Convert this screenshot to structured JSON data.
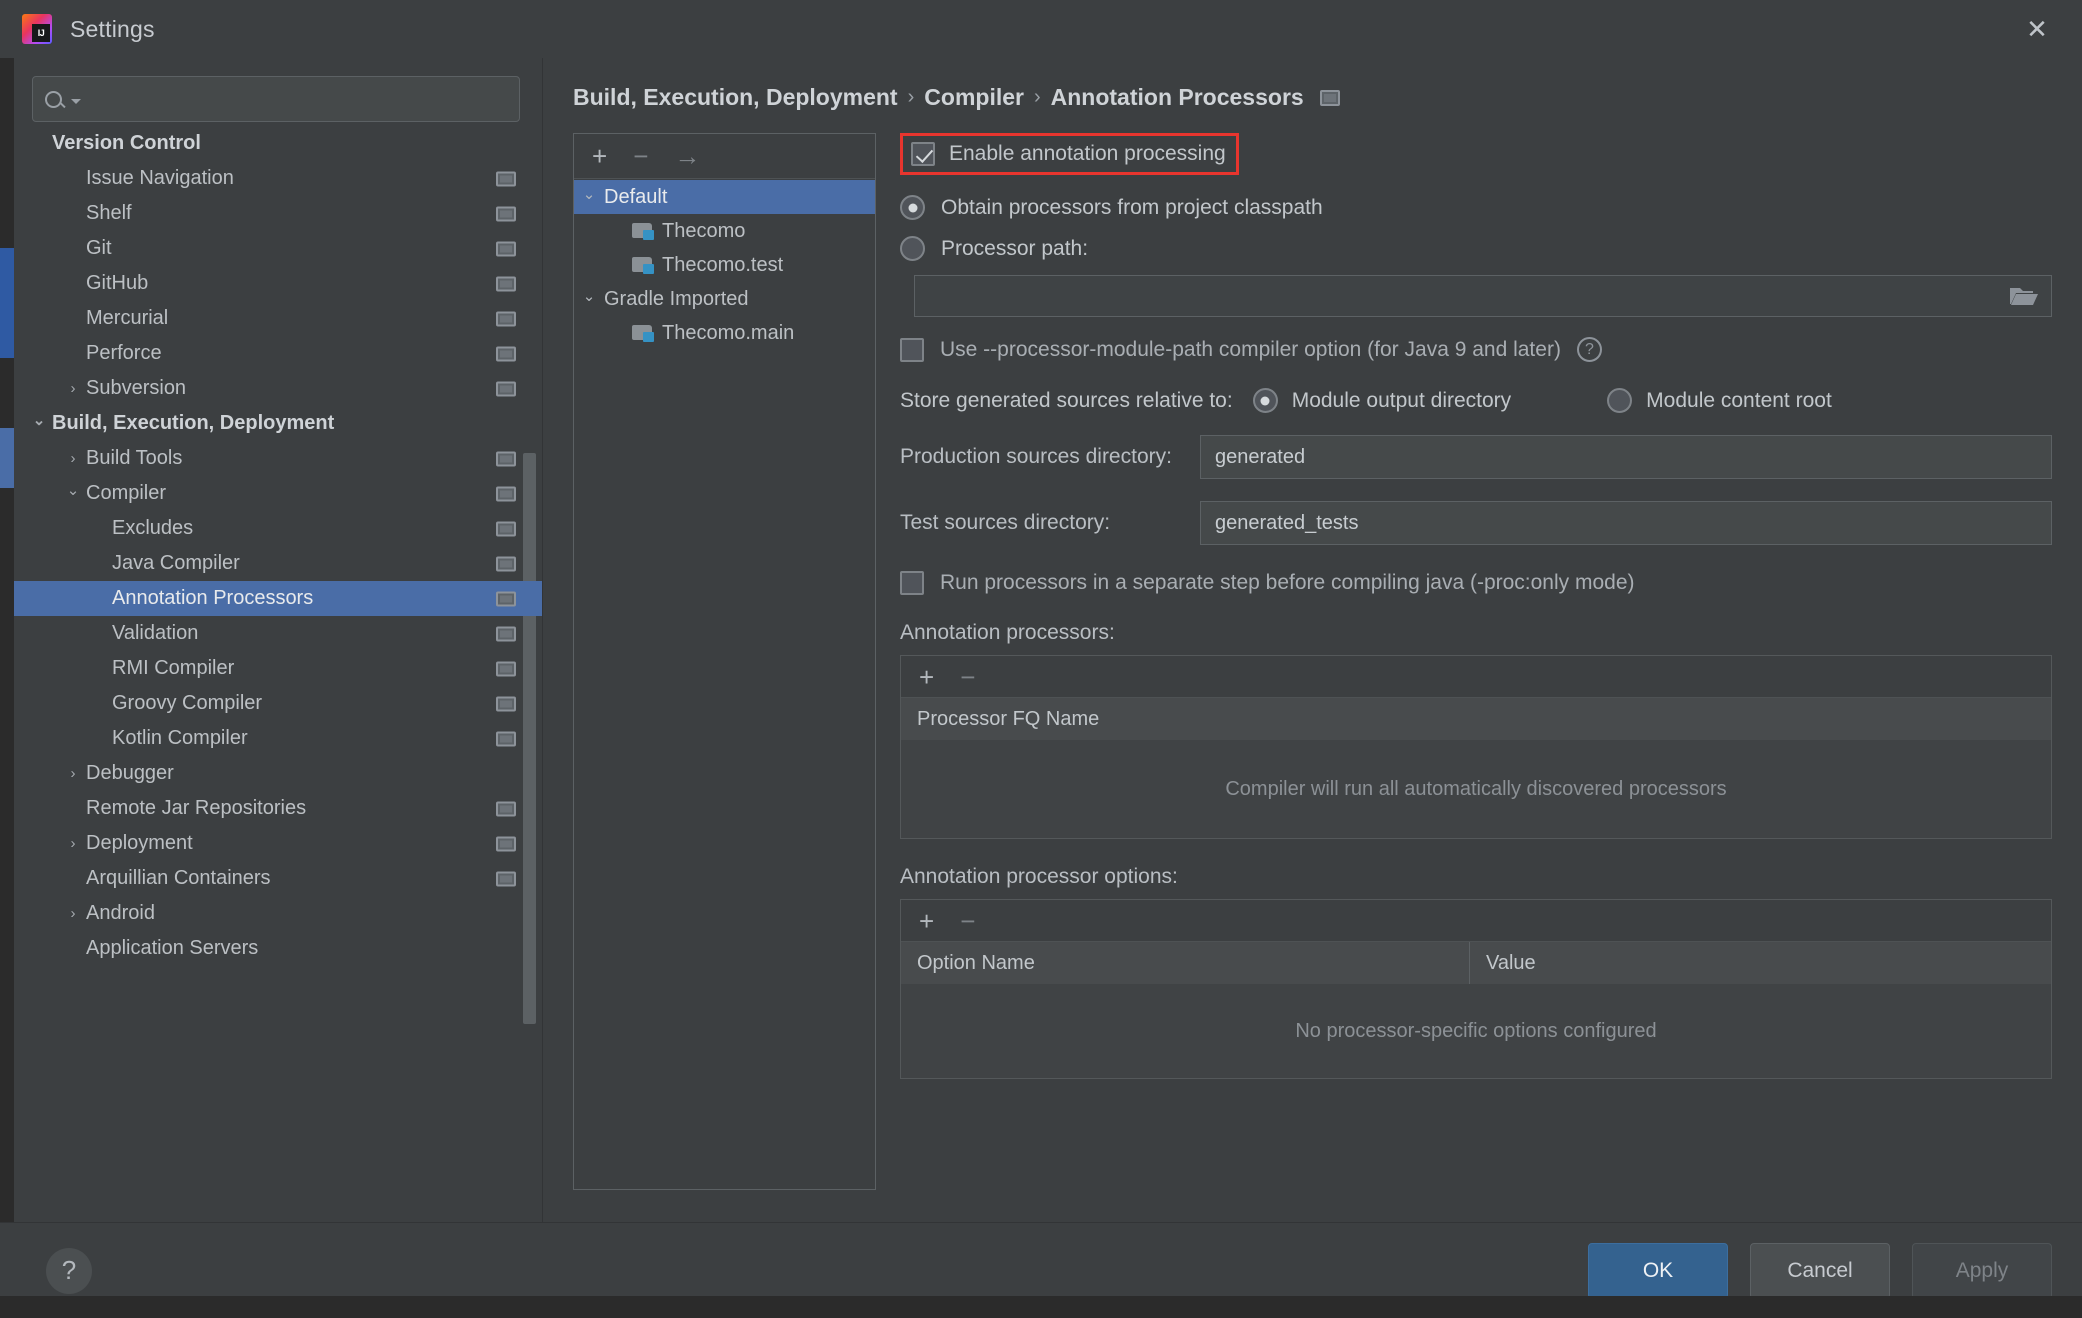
{
  "window": {
    "title": "Settings",
    "logo_icon": "intellij-idea-logo",
    "close_icon": "close-icon"
  },
  "search": {
    "value": "",
    "placeholder": "",
    "icon": "search-icon",
    "caret_icon": "chevron-down-icon"
  },
  "sidebar": {
    "scroll_thumb_top_pct": 30,
    "scroll_thumb_height_pct": 52,
    "items": [
      {
        "label": "Version Control",
        "depth": 0,
        "bold": true,
        "chevron": "",
        "badge": false,
        "selected": false
      },
      {
        "label": "Issue Navigation",
        "depth": 1,
        "bold": false,
        "chevron": "",
        "badge": true,
        "selected": false
      },
      {
        "label": "Shelf",
        "depth": 1,
        "bold": false,
        "chevron": "",
        "badge": true,
        "selected": false
      },
      {
        "label": "Git",
        "depth": 1,
        "bold": false,
        "chevron": "",
        "badge": true,
        "selected": false
      },
      {
        "label": "GitHub",
        "depth": 1,
        "bold": false,
        "chevron": "",
        "badge": true,
        "selected": false
      },
      {
        "label": "Mercurial",
        "depth": 1,
        "bold": false,
        "chevron": "",
        "badge": true,
        "selected": false
      },
      {
        "label": "Perforce",
        "depth": 1,
        "bold": false,
        "chevron": "",
        "badge": true,
        "selected": false
      },
      {
        "label": "Subversion",
        "depth": 1,
        "bold": false,
        "chevron": "collapsed",
        "badge": true,
        "selected": false
      },
      {
        "label": "Build, Execution, Deployment",
        "depth": 0,
        "bold": true,
        "chevron": "expanded",
        "badge": false,
        "selected": false
      },
      {
        "label": "Build Tools",
        "depth": 1,
        "bold": false,
        "chevron": "collapsed",
        "badge": true,
        "selected": false
      },
      {
        "label": "Compiler",
        "depth": 1,
        "bold": false,
        "chevron": "expanded",
        "badge": true,
        "selected": false
      },
      {
        "label": "Excludes",
        "depth": 2,
        "bold": false,
        "chevron": "",
        "badge": true,
        "selected": false
      },
      {
        "label": "Java Compiler",
        "depth": 2,
        "bold": false,
        "chevron": "",
        "badge": true,
        "selected": false
      },
      {
        "label": "Annotation Processors",
        "depth": 2,
        "bold": false,
        "chevron": "",
        "badge": true,
        "selected": true
      },
      {
        "label": "Validation",
        "depth": 2,
        "bold": false,
        "chevron": "",
        "badge": true,
        "selected": false
      },
      {
        "label": "RMI Compiler",
        "depth": 2,
        "bold": false,
        "chevron": "",
        "badge": true,
        "selected": false
      },
      {
        "label": "Groovy Compiler",
        "depth": 2,
        "bold": false,
        "chevron": "",
        "badge": true,
        "selected": false
      },
      {
        "label": "Kotlin Compiler",
        "depth": 2,
        "bold": false,
        "chevron": "",
        "badge": true,
        "selected": false
      },
      {
        "label": "Debugger",
        "depth": 1,
        "bold": false,
        "chevron": "collapsed",
        "badge": false,
        "selected": false
      },
      {
        "label": "Remote Jar Repositories",
        "depth": 1,
        "bold": false,
        "chevron": "",
        "badge": true,
        "selected": false
      },
      {
        "label": "Deployment",
        "depth": 1,
        "bold": false,
        "chevron": "collapsed",
        "badge": true,
        "selected": false
      },
      {
        "label": "Arquillian Containers",
        "depth": 1,
        "bold": false,
        "chevron": "",
        "badge": true,
        "selected": false
      },
      {
        "label": "Android",
        "depth": 1,
        "bold": false,
        "chevron": "collapsed",
        "badge": false,
        "selected": false
      },
      {
        "label": "Application Servers",
        "depth": 1,
        "bold": false,
        "chevron": "",
        "badge": false,
        "selected": false
      }
    ]
  },
  "breadcrumb": {
    "parts": [
      "Build, Execution, Deployment",
      "Compiler",
      "Annotation Processors"
    ],
    "separator": "›",
    "badge_icon": "ide-scope-icon"
  },
  "modules": {
    "toolbar": {
      "add_icon": "plus-icon",
      "remove_icon": "minus-icon",
      "move_icon": "arrow-right-icon"
    },
    "rows": [
      {
        "label": "Default",
        "type": "group",
        "chevron": "expanded",
        "selected": true
      },
      {
        "label": "Thecomo",
        "type": "module",
        "chevron": "",
        "selected": false
      },
      {
        "label": "Thecomo.test",
        "type": "module",
        "chevron": "",
        "selected": false
      },
      {
        "label": "Gradle Imported",
        "type": "group",
        "chevron": "expanded",
        "selected": false
      },
      {
        "label": "Thecomo.main",
        "type": "module",
        "chevron": "",
        "selected": false
      }
    ]
  },
  "form": {
    "enable_annotation_processing": {
      "label": "Enable annotation processing",
      "checked": true,
      "highlight_color": "#e8352e"
    },
    "processor_source": {
      "selected": "classpath",
      "options": [
        {
          "id": "classpath",
          "label": "Obtain processors from project classpath"
        },
        {
          "id": "path",
          "label": "Processor path:"
        }
      ]
    },
    "processor_path": {
      "value": "",
      "placeholder": "",
      "browse_icon": "folder-icon"
    },
    "use_processor_module_path": {
      "label": "Use --processor-module-path compiler option (for Java 9 and later)",
      "checked": false,
      "help_icon": "help-circle-icon"
    },
    "store_generated": {
      "label": "Store generated sources relative to:",
      "selected": "module_output",
      "options": [
        {
          "id": "module_output",
          "label": "Module output directory"
        },
        {
          "id": "content_root",
          "label": "Module content root"
        }
      ]
    },
    "production_sources": {
      "label": "Production sources directory:",
      "value": "generated",
      "placeholder": ""
    },
    "test_sources": {
      "label": "Test sources directory:",
      "value": "generated_tests",
      "placeholder": ""
    },
    "run_separate_step": {
      "label": "Run processors in a separate step before compiling java (-proc:only mode)",
      "checked": false
    },
    "processors_table": {
      "section_label": "Annotation processors:",
      "add_icon": "plus-icon",
      "remove_icon": "minus-icon",
      "columns": [
        "Processor FQ Name"
      ],
      "rows": [],
      "empty_text": "Compiler will run all automatically discovered processors"
    },
    "options_table": {
      "section_label": "Annotation processor options:",
      "add_icon": "plus-icon",
      "remove_icon": "minus-icon",
      "columns": [
        "Option Name",
        "Value"
      ],
      "rows": [],
      "empty_text": "No processor-specific options configured"
    }
  },
  "footer": {
    "help_icon": "question-mark-icon",
    "ok_label": "OK",
    "cancel_label": "Cancel",
    "apply_label": "Apply"
  }
}
